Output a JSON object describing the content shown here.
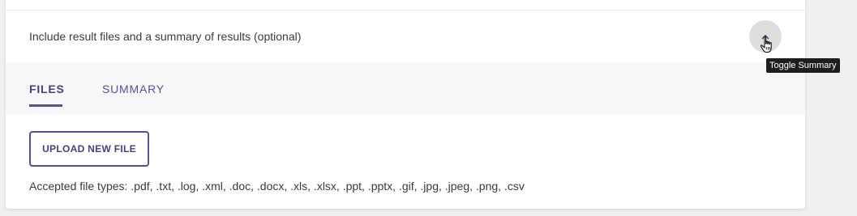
{
  "panel": {
    "header_text": "Include result files and a summary of results (optional)",
    "toggle_icon": "chevron-up-icon",
    "tooltip": "Toggle Summary"
  },
  "tabs": [
    {
      "label": "FILES",
      "active": true
    },
    {
      "label": "SUMMARY",
      "active": false
    }
  ],
  "files": {
    "upload_label": "UPLOAD NEW FILE",
    "accepted_text": "Accepted file types: .pdf, .txt, .log, .xml, .doc, .docx, .xls, .xlsx, .ppt, .pptx, .gif, .jpg, .jpeg, .png, .csv"
  },
  "colors": {
    "accent": "#5b4e96",
    "accent_dark": "#4a3f7a",
    "tabs_background": "#f7f7f7",
    "toggle_background": "#dedede"
  }
}
